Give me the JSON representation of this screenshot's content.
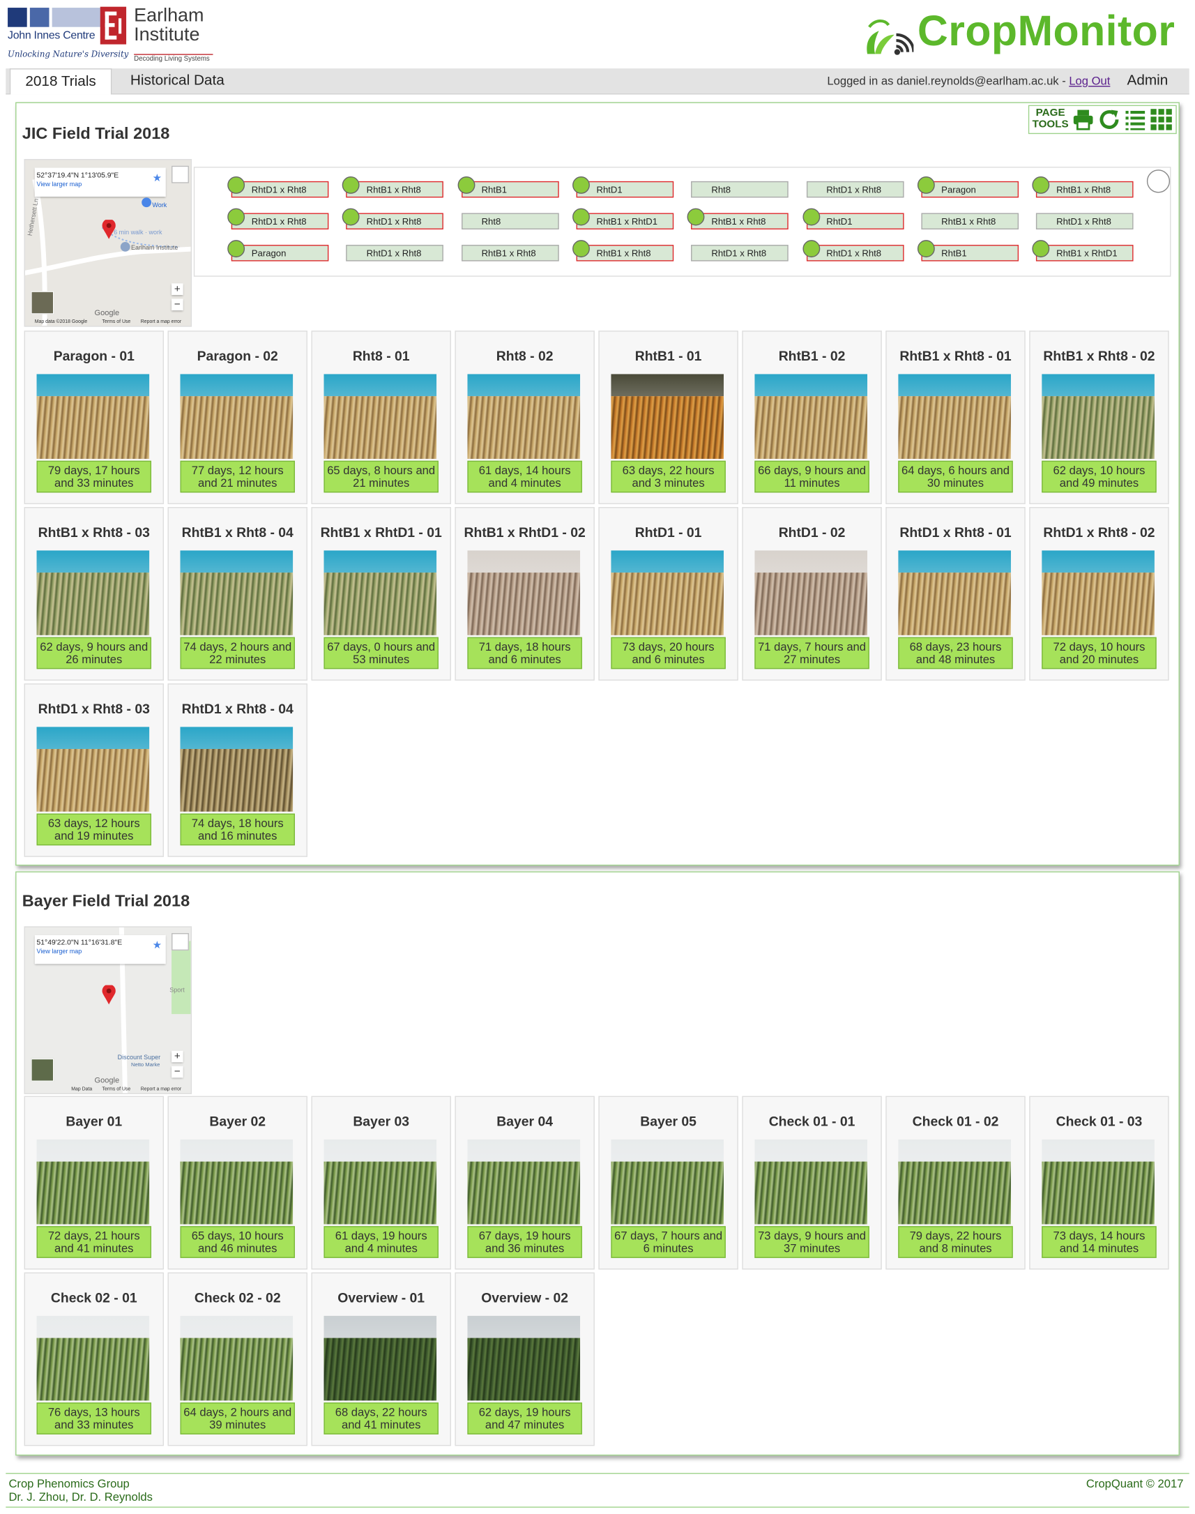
{
  "header": {
    "jic_name": "John Innes Centre",
    "jic_tagline": "Unlocking Nature's Diversity",
    "ei_name": "Earlham\nInstitute",
    "ei_tagline": "Decoding Living Systems",
    "app_title": "CropMonitor"
  },
  "nav": {
    "tabs": [
      {
        "label": "2018 Trials",
        "active": true
      },
      {
        "label": "Historical Data",
        "active": false
      }
    ],
    "login_prefix": "Logged in as daniel.reynolds@earlham.ac.uk - ",
    "logout_label": "Log Out",
    "admin_label": "Admin"
  },
  "page_tools": {
    "label": "PAGE TOOLS",
    "icons": [
      "print-icon",
      "refresh-icon",
      "list-view-icon",
      "grid-view-icon"
    ]
  },
  "trials": [
    {
      "title": "JIC Field Trial 2018",
      "map": {
        "coords": "52°37'19.4\"N 1°13'05.9\"E",
        "link": "View larger map",
        "labels": [
          "Work",
          "6 min walk · work",
          "Earlham Institute",
          "Hethersett Ln",
          "Google",
          "Map data ©2018 Google",
          "Terms of Use",
          "Report a map error"
        ]
      },
      "plot_layout": [
        [
          {
            "label": "RhtD1 x Rht8",
            "dot": true,
            "highlight": true
          },
          {
            "label": "RhtB1 x Rht8",
            "dot": true,
            "highlight": true
          },
          {
            "label": "RhtB1",
            "dot": true,
            "highlight": true
          },
          {
            "label": "RhtD1",
            "dot": true,
            "highlight": true
          },
          {
            "label": "Rht8",
            "dot": false,
            "highlight": false
          },
          {
            "label": "RhtD1 x Rht8",
            "dot": false,
            "highlight": false
          },
          {
            "label": "Paragon",
            "dot": true,
            "highlight": true
          },
          {
            "label": "RhtB1 x Rht8",
            "dot": true,
            "highlight": true
          }
        ],
        [
          {
            "label": "RhtD1 x Rht8",
            "dot": true,
            "highlight": true
          },
          {
            "label": "RhtD1 x Rht8",
            "dot": true,
            "highlight": true
          },
          {
            "label": "Rht8",
            "dot": false,
            "highlight": false
          },
          {
            "label": "RhtB1 x RhtD1",
            "dot": true,
            "highlight": true
          },
          {
            "label": "RhtB1 x Rht8",
            "dot": true,
            "highlight": true
          },
          {
            "label": "RhtD1",
            "dot": true,
            "highlight": true
          },
          {
            "label": "RhtB1 x Rht8",
            "dot": false,
            "highlight": false
          },
          {
            "label": "RhtD1 x Rht8",
            "dot": false,
            "highlight": false
          }
        ],
        [
          {
            "label": "Paragon",
            "dot": true,
            "highlight": true
          },
          {
            "label": "RhtD1 x Rht8",
            "dot": false,
            "highlight": false
          },
          {
            "label": "RhtB1 x Rht8",
            "dot": false,
            "highlight": false
          },
          {
            "label": "RhtB1 x Rht8",
            "dot": true,
            "highlight": true
          },
          {
            "label": "RhtD1 x Rht8",
            "dot": false,
            "highlight": false
          },
          {
            "label": "RhtD1 x Rht8",
            "dot": true,
            "highlight": true
          },
          {
            "label": "RhtB1",
            "dot": true,
            "highlight": true
          },
          {
            "label": "RhtB1 x RhtD1",
            "dot": true,
            "highlight": true
          }
        ]
      ],
      "cards": [
        {
          "title": "Paragon - 01",
          "time": "79 days, 17 hours and 33 minutes",
          "tone": "golden"
        },
        {
          "title": "Paragon - 02",
          "time": "77 days, 12 hours and 21 minutes",
          "tone": "golden"
        },
        {
          "title": "Rht8 - 01",
          "time": "65 days, 8 hours and 21 minutes",
          "tone": "golden"
        },
        {
          "title": "Rht8 - 02",
          "time": "61 days, 14 hours and 4 minutes",
          "tone": "golden"
        },
        {
          "title": "RhtB1 - 01",
          "time": "63 days, 22 hours and 3 minutes",
          "tone": "orange"
        },
        {
          "title": "RhtB1 - 02",
          "time": "66 days, 9 hours and 11 minutes",
          "tone": "golden"
        },
        {
          "title": "RhtB1 x Rht8 - 01",
          "time": "64 days, 6 hours and 30 minutes",
          "tone": "golden"
        },
        {
          "title": "RhtB1 x Rht8 - 02",
          "time": "62 days, 10 hours and 49 minutes",
          "tone": "green-gold"
        },
        {
          "title": "RhtB1 x Rht8 - 03",
          "time": "62 days, 9 hours and 26 minutes",
          "tone": "green-gold"
        },
        {
          "title": "RhtB1 x Rht8 - 04",
          "time": "74 days, 2 hours and 22 minutes",
          "tone": "green-gold"
        },
        {
          "title": "RhtB1 x RhtD1 - 01",
          "time": "67 days, 0 hours and 53 minutes",
          "tone": "green-gold"
        },
        {
          "title": "RhtB1 x RhtD1 - 02",
          "time": "71 days, 18 hours and 6 minutes",
          "tone": "hazy"
        },
        {
          "title": "RhtD1 - 01",
          "time": "73 days, 20 hours and 6 minutes",
          "tone": "golden"
        },
        {
          "title": "RhtD1 - 02",
          "time": "71 days, 7 hours and 27 minutes",
          "tone": "hazy"
        },
        {
          "title": "RhtD1 x Rht8 - 01",
          "time": "68 days, 23 hours and 48 minutes",
          "tone": "golden"
        },
        {
          "title": "RhtD1 x Rht8 - 02",
          "time": "72 days, 10 hours and 20 minutes",
          "tone": "golden"
        },
        {
          "title": "RhtD1 x Rht8 - 03",
          "time": "63 days, 12 hours and 19 minutes",
          "tone": "golden"
        },
        {
          "title": "RhtD1 x Rht8 - 04",
          "time": "74 days, 18 hours and 16 minutes",
          "tone": "dark-gold"
        }
      ]
    },
    {
      "title": "Bayer Field Trial 2018",
      "map": {
        "coords": "51°49'22.0\"N 11°16'31.8\"E",
        "link": "View larger map",
        "labels": [
          "Sport",
          "Discount Super",
          "Netto Marke",
          "Google",
          "Map Data",
          "Terms of Use",
          "Report a map error"
        ]
      },
      "cards": [
        {
          "title": "Bayer 01",
          "time": "72 days, 21 hours and 41 minutes",
          "tone": "green"
        },
        {
          "title": "Bayer 02",
          "time": "65 days, 10 hours and 46 minutes",
          "tone": "green"
        },
        {
          "title": "Bayer 03",
          "time": "61 days, 19 hours and 4 minutes",
          "tone": "green"
        },
        {
          "title": "Bayer 04",
          "time": "67 days, 19 hours and 36 minutes",
          "tone": "green"
        },
        {
          "title": "Bayer 05",
          "time": "67 days, 7 hours and 6 minutes",
          "tone": "green"
        },
        {
          "title": "Check 01 - 01",
          "time": "73 days, 9 hours and 37 minutes",
          "tone": "green"
        },
        {
          "title": "Check 01 - 02",
          "time": "79 days, 22 hours and 8 minutes",
          "tone": "green"
        },
        {
          "title": "Check 01 - 03",
          "time": "73 days, 14 hours and 14 minutes",
          "tone": "green"
        },
        {
          "title": "Check 02 - 01",
          "time": "76 days, 13 hours and 33 minutes",
          "tone": "green"
        },
        {
          "title": "Check 02 - 02",
          "time": "64 days, 2 hours and 39 minutes",
          "tone": "green"
        },
        {
          "title": "Overview - 01",
          "time": "68 days, 22 hours and 41 minutes",
          "tone": "overview"
        },
        {
          "title": "Overview - 02",
          "time": "62 days, 19 hours and 47 minutes",
          "tone": "overview"
        }
      ]
    }
  ],
  "footer": {
    "group": "Crop Phenomics Group",
    "authors": "Dr. J. Zhou, Dr. D. Reynolds",
    "copyright": "CropQuant © 2017"
  },
  "colors": {
    "brand_green": "#5cb82b",
    "time_badge": "#a6e25a",
    "panel_border": "#9dd28a",
    "plot_highlight": "#e0282c"
  }
}
